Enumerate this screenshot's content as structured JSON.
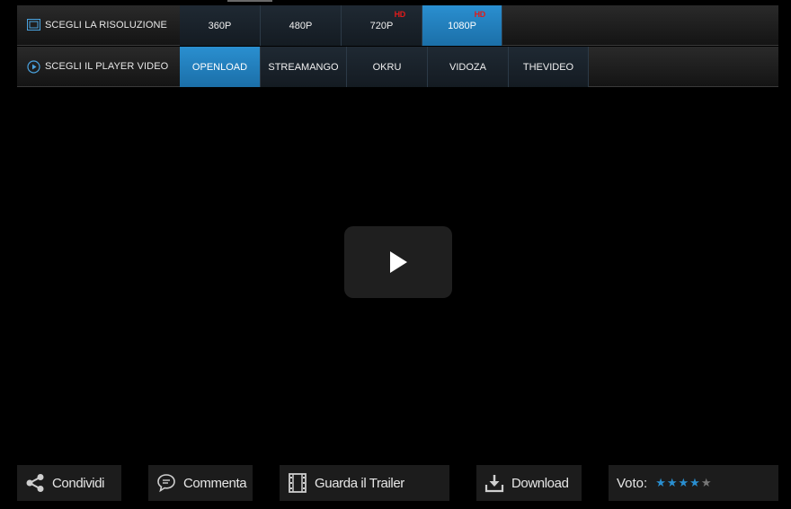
{
  "resolution": {
    "label": "SCEGLI LA RISOLUZIONE",
    "options": [
      {
        "label": "360P"
      },
      {
        "label": "480P"
      },
      {
        "label": "720P",
        "badge": "HD"
      },
      {
        "label": "1080P",
        "badge": "HD"
      }
    ],
    "selected": "1080P"
  },
  "player": {
    "label": "SCEGLI IL PLAYER VIDEO",
    "options": [
      {
        "label": "OPENLOAD"
      },
      {
        "label": "STREAMANGO"
      },
      {
        "label": "OKRU"
      },
      {
        "label": "VIDOZA"
      },
      {
        "label": "THEVIDEO"
      }
    ],
    "selected": "OPENLOAD"
  },
  "video": {
    "play_icon": "play-icon"
  },
  "actions": {
    "share": {
      "label": "Condividi",
      "icon": "share-icon"
    },
    "comment": {
      "label": "Commenta",
      "icon": "comment-icon"
    },
    "trailer": {
      "label": "Guarda il Trailer",
      "icon": "film-icon"
    },
    "download": {
      "label": "Download",
      "icon": "download-icon"
    }
  },
  "vote": {
    "label": "Voto:",
    "rating": 4,
    "max": 5
  },
  "colors": {
    "accent": "#2a8fd0",
    "hd_badge": "#e01b1b",
    "star_on": "#2a8fd0",
    "star_off": "#777777"
  }
}
